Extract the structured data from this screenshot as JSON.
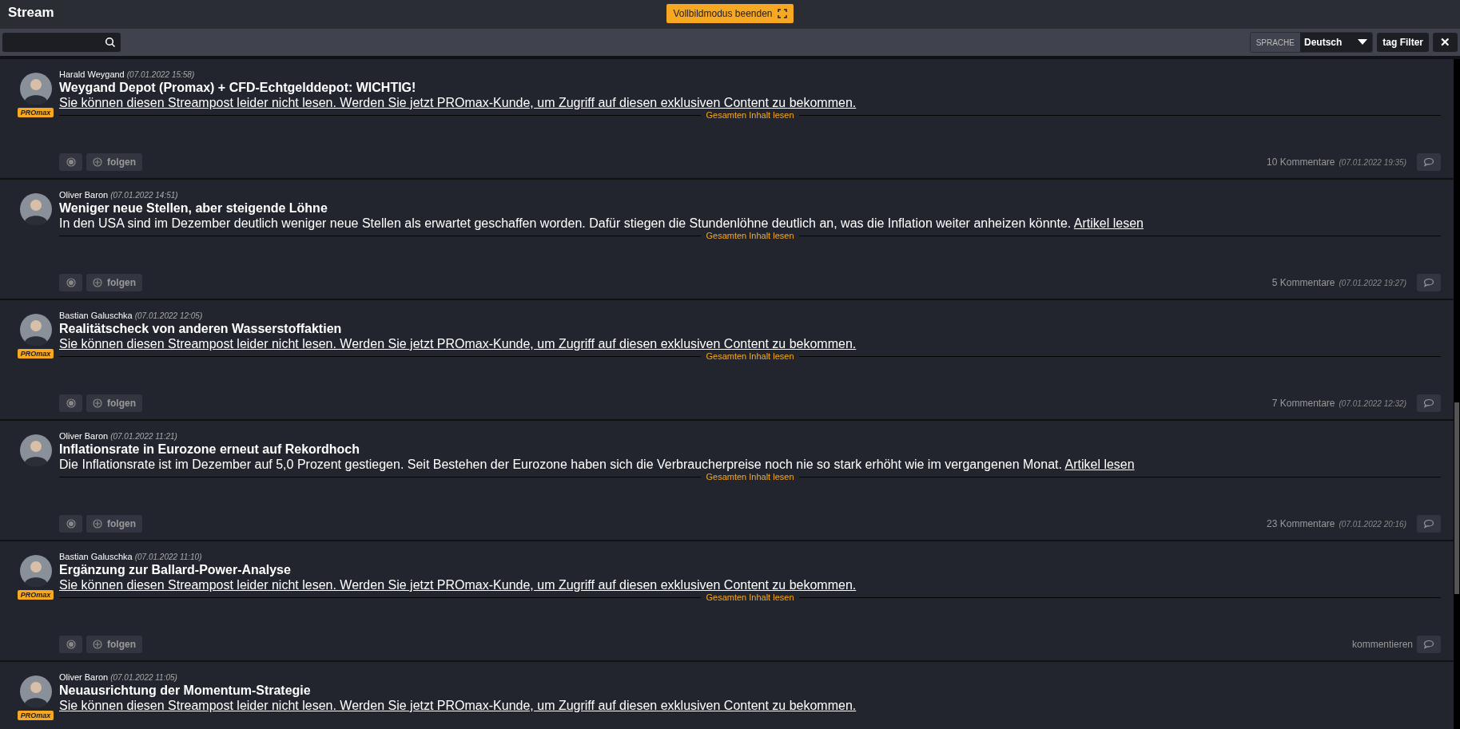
{
  "header": {
    "title": "Stream",
    "fullscreen_button": "Vollbildmodus beenden"
  },
  "toolbar": {
    "language_label": "SPRACHE",
    "language": "Deutsch",
    "tag_filter": "tag Filter",
    "close": "✕"
  },
  "posts": [
    {
      "author": "Harald Weygand",
      "date": "(07.01.2022 15:58)",
      "badge": "PROmax",
      "title": "Weygand Depot (Promax) + CFD-Echtgelddepot: WICHTIG!",
      "kind": "locked",
      "link": "Sie können diesen Streampost leider nicht lesen. Werden Sie jetzt PROmax-Kunde, um Zugriff auf diesen exklusiven Content zu bekommen.",
      "read_more": "Gesamten Inhalt lesen",
      "follow": "folgen",
      "comments": "10 Kommentare",
      "comments_date": "(07.01.2022 19:35)"
    },
    {
      "author": "Oliver Baron",
      "date": "(07.01.2022 14:51)",
      "title": "Weniger neue Stellen, aber steigende Löhne",
      "kind": "teaser",
      "body": "In den USA sind im Dezember deutlich weniger neue Stellen als erwartet geschaffen worden. Dafür stiegen die Stundenlöhne deutlich an, was die Inflation weiter anheizen könnte.",
      "link": "Artikel lesen",
      "read_more": "Gesamten Inhalt lesen",
      "follow": "folgen",
      "comments": "5 Kommentare",
      "comments_date": "(07.01.2022 19:27)"
    },
    {
      "author": "Bastian Galuschka",
      "date": "(07.01.2022 12:05)",
      "badge": "PROmax",
      "title": "Realitätscheck von anderen Wasserstoffaktien",
      "kind": "locked",
      "link": "Sie können diesen Streampost leider nicht lesen. Werden Sie jetzt PROmax-Kunde, um Zugriff auf diesen exklusiven Content zu bekommen.",
      "read_more": "Gesamten Inhalt lesen",
      "follow": "folgen",
      "comments": "7 Kommentare",
      "comments_date": "(07.01.2022 12:32)"
    },
    {
      "author": "Oliver Baron",
      "date": "(07.01.2022 11:21)",
      "title": "Inflationsrate in Eurozone erneut auf Rekordhoch",
      "kind": "teaser",
      "body": "Die Inflationsrate ist im Dezember auf 5,0 Prozent gestiegen. Seit Bestehen der Eurozone haben sich die Verbraucherpreise noch nie so stark erhöht wie im vergangenen Monat.",
      "link": "Artikel lesen",
      "read_more": "Gesamten Inhalt lesen",
      "follow": "folgen",
      "comments": "23 Kommentare",
      "comments_date": "(07.01.2022 20:16)"
    },
    {
      "author": "Bastian Galuschka",
      "date": "(07.01.2022 11:10)",
      "badge": "PROmax",
      "title": "Ergänzung zur Ballard-Power-Analyse",
      "kind": "locked",
      "link": "Sie können diesen Streampost leider nicht lesen. Werden Sie jetzt PROmax-Kunde, um Zugriff auf diesen exklusiven Content zu bekommen.",
      "read_more": "Gesamten Inhalt lesen",
      "follow": "folgen",
      "comments": "kommentieren"
    },
    {
      "author": "Oliver Baron",
      "date": "(07.01.2022 11:05)",
      "badge": "PROmax",
      "title": "Neuausrichtung der Momentum-Strategie",
      "kind": "locked",
      "link": "Sie können diesen Streampost leider nicht lesen. Werden Sie jetzt PROmax-Kunde, um Zugriff auf diesen exklusiven Content zu bekommen."
    }
  ]
}
